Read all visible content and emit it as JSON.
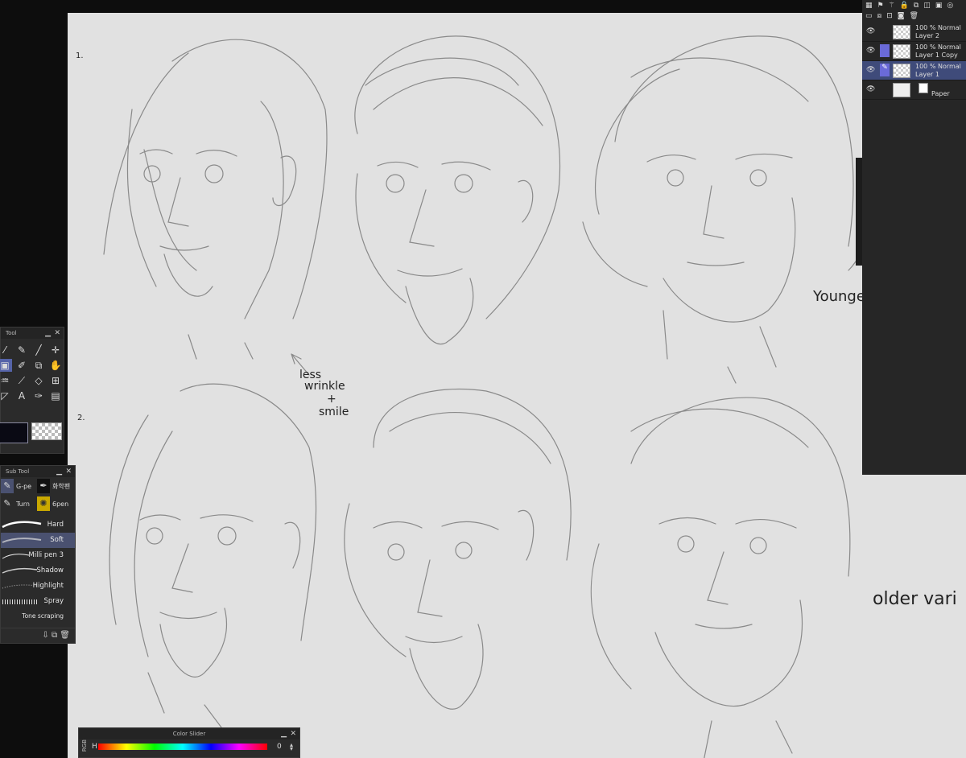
{
  "tool_panel": {
    "title": "Tool",
    "icons": [
      "airbrush-icon",
      "eyedropper-icon",
      "pen-icon",
      "move-icon",
      "fill-icon",
      "pencil-icon",
      "transform-icon",
      "hand-icon",
      "blend-icon",
      "line-icon",
      "eraser-icon",
      "frame-icon",
      "ruler-icon",
      "text-icon",
      "balloon-icon",
      "gradient-icon"
    ]
  },
  "sub_tool_panel": {
    "title": "Sub Tool",
    "groups": [
      {
        "label": "G-pe"
      },
      {
        "label": "화학펜"
      },
      {
        "label": "Turn"
      },
      {
        "label": "6pen"
      }
    ],
    "brushes": [
      {
        "label": "Hard"
      },
      {
        "label": "Soft"
      },
      {
        "label": "Milli pen 3"
      },
      {
        "label": "Shadow"
      },
      {
        "label": "Highlight"
      },
      {
        "label": "Spray"
      },
      {
        "label": "Tone scraping"
      }
    ],
    "selected_brush": "Soft"
  },
  "color_slider": {
    "title": "Color Slider",
    "mode": "RGB",
    "channel": "H",
    "value": "0"
  },
  "layer_panel": {
    "layers": [
      {
        "mode": "100 % Normal",
        "name": "Layer 2",
        "selected": false
      },
      {
        "mode": "100 % Normal",
        "name": "Layer 1 Copy",
        "selected": false
      },
      {
        "mode": "100 % Normal",
        "name": "Layer 1",
        "selected": true
      },
      {
        "mode": "",
        "name": "Paper",
        "selected": false
      }
    ]
  },
  "canvas_notes": {
    "row1": "1.",
    "row2": "2.",
    "feedback_line1": "less",
    "feedback_line2": "wrinkle",
    "feedback_line3": "+",
    "feedback_line4": "smile",
    "younger": "Younge",
    "older": "older vari"
  }
}
